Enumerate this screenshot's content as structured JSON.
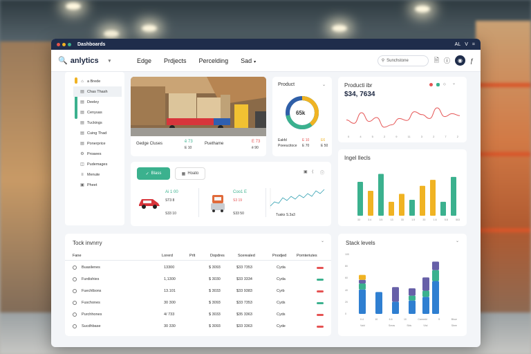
{
  "window": {
    "title": "Dashboards",
    "top_right": [
      "AL",
      "V",
      "="
    ]
  },
  "brand": {
    "label": "anlytics"
  },
  "nav": {
    "links": [
      "Edge",
      "Prdjects",
      "Percelding",
      "Sad"
    ],
    "search_placeholder": "Sunchstone"
  },
  "sidebar": {
    "items": [
      {
        "icon": "home-icon",
        "label": "a Brede"
      },
      {
        "icon": "doc-icon",
        "label": "Chas Thash"
      },
      {
        "icon": "doc-icon",
        "label": "Deeley"
      },
      {
        "icon": "doc-icon",
        "label": "Cenyuas"
      },
      {
        "icon": "doc-icon",
        "label": "Tuckings"
      },
      {
        "icon": "doc-icon",
        "label": "Cuing Thad"
      },
      {
        "icon": "doc-icon",
        "label": "Ponerprice"
      },
      {
        "icon": "gear-icon",
        "label": "Proaees"
      },
      {
        "icon": "folder-icon",
        "label": "Pudemages"
      },
      {
        "icon": "list-icon",
        "label": "Menute"
      },
      {
        "icon": "box-icon",
        "label": "Pheet"
      }
    ]
  },
  "photo_card": {
    "left_label": "Gedge Cluses",
    "left_value": "E 10",
    "mid_value": "ē 73",
    "mid_label": "Puethame",
    "right_value": "E 73",
    "right_value_2": "ē 90"
  },
  "product_card": {
    "title": "Product",
    "donut_value": "65k",
    "donut_fraction": 0.72,
    "foot_left": "Eakfd",
    "foot_left_2": "Poeeucitoce",
    "foot_mid": "E 10",
    "foot_mid_2": "E 70",
    "foot_right": "E6",
    "foot_right_2": "E 50"
  },
  "production_card": {
    "title": "Producti ibr",
    "value": "$34, 7634",
    "axis": [
      "0",
      "4",
      "5",
      "2",
      "9",
      "11",
      "3",
      "2",
      "7",
      "2"
    ]
  },
  "mid_card": {
    "btn_primary": "Blass",
    "btn_secondary": "Hoato",
    "item1_title": "Ai 1 00",
    "item1_sub": "ST3 8",
    "item1_foot": "S33 10",
    "item2_title": "Coo1 E",
    "item2_sub": "S3 19",
    "item2_foot": "S33 50",
    "spark_label": "Tuaks S.3a3"
  },
  "ingel_card": {
    "title": "Ingel Ilecls",
    "axis": [
      "33",
      "3.4",
      "3.5",
      "13",
      "33",
      "1.5",
      "33",
      "1.6",
      "5.8",
      "503"
    ]
  },
  "stock_inventory": {
    "title": "Tock invnrry",
    "columns": [
      "Fane",
      "Lorerd",
      "Prlt",
      "Dopdres",
      "Scerealed",
      "Pnodjed",
      "Pornteriutes"
    ],
    "rows": [
      {
        "name": "Buasilenes",
        "c1": "13300",
        "c2": "$ 3093",
        "c3": "$33 7353",
        "c4": "Cyda",
        "status": "red"
      },
      {
        "name": "Furdishies",
        "c1": "1,1300",
        "c2": "$ 3030",
        "c3": "$33 3334",
        "c4": "Cyda",
        "status": "green"
      },
      {
        "name": "Fuechlbons",
        "c1": "13.101",
        "c2": "$ 3033",
        "c3": "$33 9383",
        "c4": "Cyrb",
        "status": "red"
      },
      {
        "name": "Fuschones",
        "c1": "30 300",
        "c2": "$ 3093",
        "c3": "$33 7353",
        "c4": "Cyds",
        "status": "green"
      },
      {
        "name": "Purchhones",
        "c1": "4/ 733",
        "c2": "$ 3033",
        "c3": "$35 3363",
        "c4": "Cyds",
        "status": "red"
      },
      {
        "name": "Sucdhbase",
        "c1": "30 330",
        "c2": "$ 3093",
        "c3": "$33 3363",
        "c4": "Cyde",
        "status": "red"
      }
    ]
  },
  "stock_levels": {
    "title": "Stack levels",
    "yaxis": [
      "100",
      "80",
      "60",
      "40",
      "20",
      "0"
    ],
    "axis_top": [
      "0.4",
      "10",
      "6.6",
      "10",
      "Carmeld",
      "S",
      "Bhue"
    ],
    "axis_bottom": [
      "Vaid",
      "",
      "Sreas",
      "Sbls",
      "Vbd",
      "",
      "Sbee"
    ]
  },
  "colors": {
    "navy": "#1f2d4b",
    "teal": "#3bb18e",
    "orange": "#f0b323",
    "blue": "#2f7fd1",
    "red": "#e55353",
    "purple": "#6760a8"
  },
  "chart_data": [
    {
      "type": "pie",
      "title": "Product",
      "values": [
        65,
        35
      ]
    },
    {
      "type": "line",
      "title": "Producti ibr",
      "x": [
        0,
        1,
        2,
        3,
        4,
        5,
        6,
        7,
        8,
        9,
        10,
        11,
        12,
        13,
        14,
        15
      ],
      "values": [
        55,
        48,
        70,
        52,
        60,
        40,
        45,
        58,
        54,
        72,
        66,
        58,
        80,
        62,
        68,
        64
      ]
    },
    {
      "type": "bar",
      "title": "Ingel Ilecls",
      "categories": [
        "33",
        "3.4",
        "3.5",
        "13",
        "33",
        "1.5",
        "33",
        "1.6",
        "5.8",
        "503"
      ],
      "values": [
        68,
        50,
        84,
        28,
        44,
        32,
        60,
        72,
        28,
        78
      ],
      "colors": [
        "teal",
        "orange",
        "teal",
        "orange",
        "orange",
        "teal",
        "orange",
        "orange",
        "teal",
        "teal"
      ]
    },
    {
      "type": "bar",
      "title": "Stack levels",
      "stacked": true,
      "categories": [
        "1",
        "2",
        "3",
        "4",
        "5",
        "6"
      ],
      "series": [
        {
          "values": [
            40,
            36,
            20,
            22,
            28,
            54
          ],
          "color": "blue"
        },
        {
          "values": [
            10,
            0,
            0,
            8,
            10,
            18
          ],
          "color": "teal"
        },
        {
          "values": [
            6,
            0,
            24,
            12,
            22,
            14
          ],
          "color": "purple"
        },
        {
          "values": [
            8,
            0,
            0,
            0,
            0,
            0
          ],
          "color": "orange"
        }
      ],
      "ylim": [
        0,
        100
      ]
    }
  ]
}
